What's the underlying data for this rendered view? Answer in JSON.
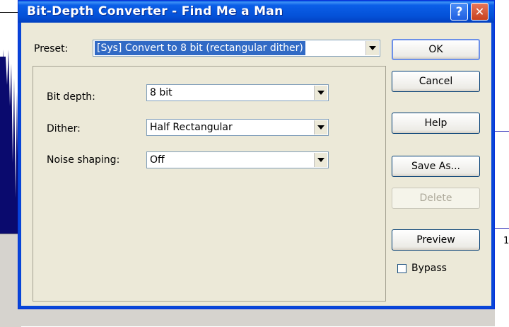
{
  "window": {
    "title": "Bit-Depth Converter - Find Me a Man",
    "help_glyph": "?",
    "close_glyph": "✕"
  },
  "preset": {
    "label": "Preset:",
    "value": "[Sys] Convert to 8 bit  (rectangular dither)"
  },
  "fields": [
    {
      "label": "Bit depth:",
      "value": "8 bit"
    },
    {
      "label": "Dither:",
      "value": "Half Rectangular"
    },
    {
      "label": "Noise shaping:",
      "value": "Off"
    }
  ],
  "buttons": {
    "ok": "OK",
    "cancel": "Cancel",
    "help": "Help",
    "save_as": "Save As...",
    "delete": "Delete",
    "preview": "Preview"
  },
  "bypass": {
    "label": "Bypass",
    "checked": false
  },
  "background": {
    "ruler_partial_text": "1"
  },
  "colors": {
    "titlebar": "#0451d8",
    "selection": "#316ac5",
    "dialog_bg": "#ece9d8"
  }
}
